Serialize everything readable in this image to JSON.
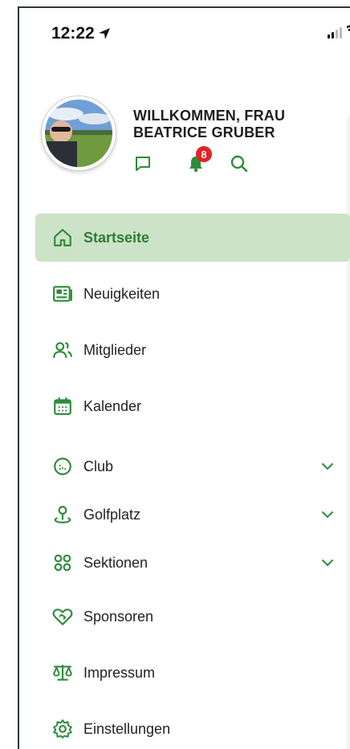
{
  "status_bar": {
    "time": "12:22"
  },
  "profile": {
    "welcome": "WILLKOMMEN, FRAU BEATRICE GRUBER",
    "notification_count": "8"
  },
  "colors": {
    "accent": "#2e8b3a",
    "active_bg": "#cde3c8",
    "badge": "#e02424"
  },
  "menu": {
    "items": [
      {
        "label": "Startseite",
        "icon": "home-icon"
      },
      {
        "label": "Neuigkeiten",
        "icon": "newspaper-icon"
      },
      {
        "label": "Mitglieder",
        "icon": "users-icon"
      },
      {
        "label": "Kalender",
        "icon": "calendar-icon"
      },
      {
        "label": "Club",
        "icon": "golf-ball-icon"
      },
      {
        "label": "Golfplatz",
        "icon": "map-pin-icon"
      },
      {
        "label": "Sektionen",
        "icon": "grid-circles-icon"
      },
      {
        "label": "Sponsoren",
        "icon": "heart-handshake-icon"
      },
      {
        "label": "Impressum",
        "icon": "scales-icon"
      },
      {
        "label": "Einstellungen",
        "icon": "settings-icon"
      }
    ]
  }
}
